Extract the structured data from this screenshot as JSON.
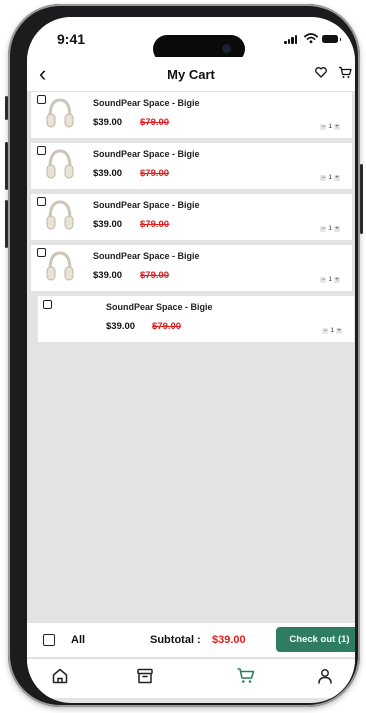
{
  "status_bar": {
    "time": "9:41"
  },
  "header": {
    "title": "My Cart",
    "back_icon": "chevron-left-icon",
    "heart_icon": "heart-icon",
    "cart_icon": "cart-icon"
  },
  "cart": {
    "items": [
      {
        "name": "SoundPear Space - Bigie",
        "price": "$39.00",
        "original_price": "$79.00",
        "quantity": "1",
        "selected": false
      },
      {
        "name": "SoundPear Space - Bigie",
        "price": "$39.00",
        "original_price": "$79.00",
        "quantity": "1",
        "selected": false
      },
      {
        "name": "SoundPear Space - Bigie",
        "price": "$39.00",
        "original_price": "$79.00",
        "quantity": "1",
        "selected": false
      },
      {
        "name": "SoundPear Space - Bigie",
        "price": "$39.00",
        "original_price": "$79.00",
        "quantity": "1",
        "selected": false
      },
      {
        "name": "SoundPear Space - Bigie",
        "price": "$39.00",
        "original_price": "$79.00",
        "quantity": "1",
        "selected": false
      }
    ]
  },
  "footer": {
    "all_label": "All",
    "subtotal_label": "Subtotal :",
    "subtotal_value": "$39.00",
    "checkout_label": "Check out (1)"
  },
  "tabbar": {
    "tabs": [
      {
        "icon": "home-icon",
        "active": false
      },
      {
        "icon": "archive-icon",
        "active": false
      },
      {
        "icon": "cart-icon",
        "active": true
      },
      {
        "icon": "profile-icon",
        "active": false
      }
    ]
  },
  "colors": {
    "accent": "#2e7d63",
    "sale": "#e02020",
    "background": "#e3e3e3"
  }
}
